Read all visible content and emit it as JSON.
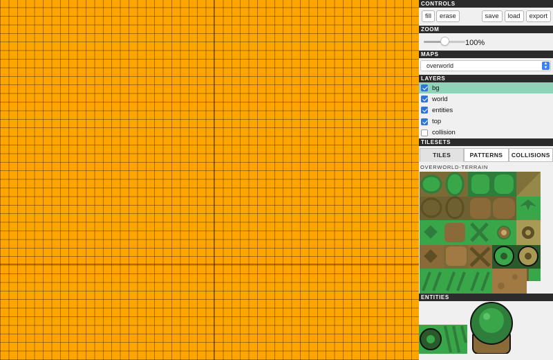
{
  "canvas": {
    "background_color": "#ffa500"
  },
  "sections": {
    "controls": "CONTROLS",
    "zoom": "ZOOM",
    "maps": "MAPS",
    "layers": "LAYERS",
    "tilesets": "TILESETS",
    "entities": "ENTITIES"
  },
  "controls": {
    "fill_label": "fill",
    "erase_label": "erase",
    "save_label": "save",
    "load_label": "load",
    "export_label": "export"
  },
  "zoom": {
    "value_label": "100%",
    "level": 0.5
  },
  "maps": {
    "selected": "overworld"
  },
  "layers": [
    {
      "label": "bg",
      "checked": true,
      "active": true
    },
    {
      "label": "world",
      "checked": true,
      "active": false
    },
    {
      "label": "entities",
      "checked": true,
      "active": false
    },
    {
      "label": "top",
      "checked": true,
      "active": false
    },
    {
      "label": "collision",
      "checked": false,
      "active": false
    }
  ],
  "tilesets": {
    "tabs": [
      "TILES",
      "PATTERNS",
      "COLLISIONS"
    ],
    "active_tab": "TILES",
    "name": "OVERWORLD-TERRAIN"
  },
  "colors": {
    "header_bg": "#2b2b2b",
    "active_layer": "#8fd4b8",
    "checkbox": "#2e74d9",
    "grass_dark": "#2f7d3a",
    "grass_light": "#3aa64a",
    "dirt": "#8b6a3a",
    "sand": "#a89a55"
  }
}
